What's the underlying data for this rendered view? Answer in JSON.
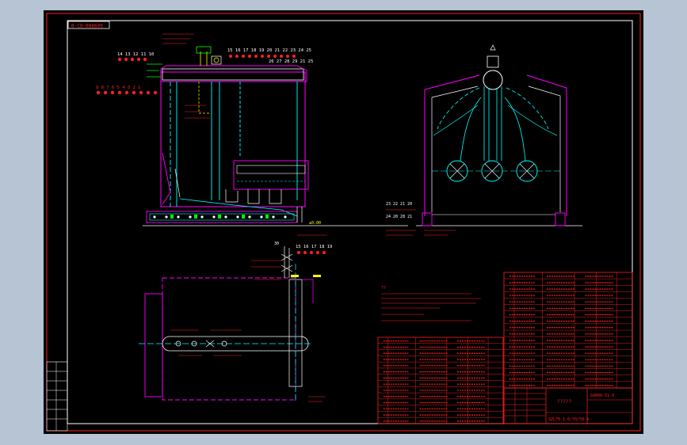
{
  "drawing": {
    "title_tag": "B-CO-008609",
    "right_title_block": {
      "title": "?????",
      "drawing_number": "G9000-51-0",
      "model_line": "SZL70-1.6/70/50-A"
    },
    "left_elevation_labels": {
      "top_cluster": [
        "14 13 12 11 10"
      ],
      "left_row": [
        "9 8 7 6 5 4 3 2 1"
      ],
      "top_right_row": [
        "15 16 17 18 19 20 21 22 23 24 25"
      ],
      "second_right_row": [
        "26 27 28 29 21 25"
      ],
      "ground_mark": "±0.00"
    },
    "front_view_labels": {
      "small_callout": [
        "23 22 21 20",
        "24 20 28 21"
      ]
    },
    "plan_view_labels": {
      "top_row": [
        "15 16 17 18 19"
      ],
      "left_mark": "30"
    },
    "notes_heading": "??",
    "colors": {
      "frame": "#ff0000",
      "outline": "#ffffff",
      "structure_cyan": "#00ffff",
      "structure_magenta": "#ff00ff",
      "annotation_red": "#ff2020",
      "annotation_green": "#00ff00",
      "annotation_yellow": "#ffff00"
    }
  }
}
